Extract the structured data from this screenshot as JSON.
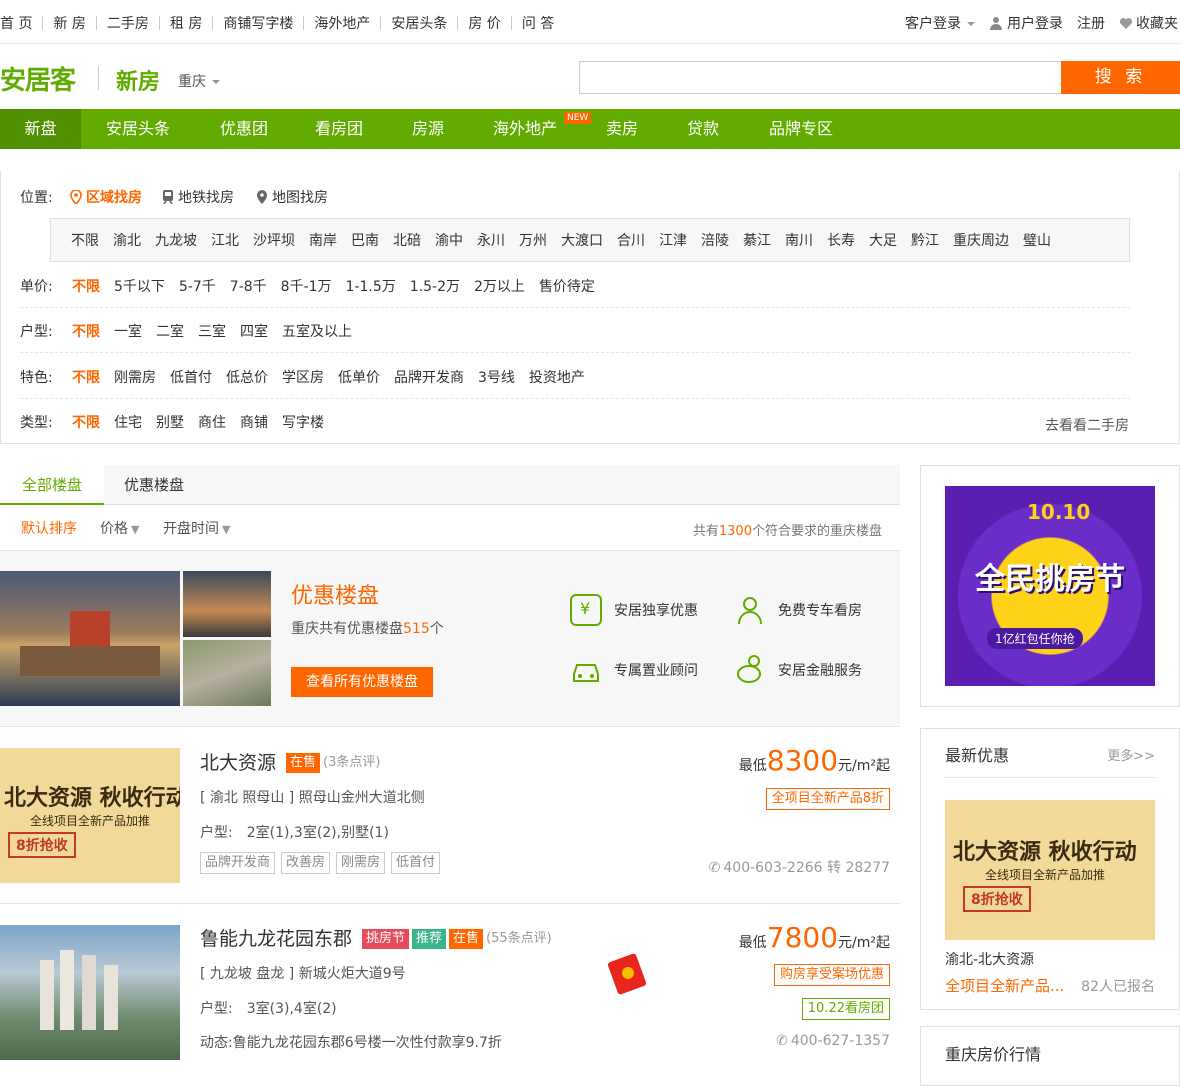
{
  "topbar": {
    "nav": [
      "首 页",
      "新 房",
      "二手房",
      "租 房",
      "商铺写字楼",
      "海外地产",
      "安居头条",
      "房 价",
      "问 答"
    ],
    "customer_login": "客户登录",
    "user_login": "用户登录",
    "register": "注册",
    "favorites": "收藏夹"
  },
  "header": {
    "logo": "安居客",
    "section": "新房",
    "city": "重庆",
    "search_placeholder": "",
    "search_button": "搜 索"
  },
  "mainnav": {
    "items": [
      "新盘",
      "安居头条",
      "优惠团",
      "看房团",
      "房源",
      "海外地产",
      "卖房",
      "贷款",
      "品牌专区"
    ],
    "new_badge": "NEW"
  },
  "filter": {
    "location_label": "位置:",
    "location_tabs": [
      "区域找房",
      "地铁找房",
      "地图找房"
    ],
    "regions": [
      "不限",
      "渝北",
      "九龙坡",
      "江北",
      "沙坪坝",
      "南岸",
      "巴南",
      "北碚",
      "渝中",
      "永川",
      "万州",
      "大渡口",
      "合川",
      "江津",
      "涪陵",
      "綦江",
      "南川",
      "长寿",
      "大足",
      "黔江",
      "重庆周边",
      "璧山"
    ],
    "price_label": "单价:",
    "prices": [
      "不限",
      "5千以下",
      "5-7千",
      "7-8千",
      "8千-1万",
      "1-1.5万",
      "1.5-2万",
      "2万以上",
      "售价待定"
    ],
    "layout_label": "户型:",
    "layouts": [
      "不限",
      "一室",
      "二室",
      "三室",
      "四室",
      "五室及以上"
    ],
    "feature_label": "特色:",
    "features": [
      "不限",
      "刚需房",
      "低首付",
      "低总价",
      "学区房",
      "低单价",
      "品牌开发商",
      "3号线",
      "投资地产"
    ],
    "type_label": "类型:",
    "types": [
      "不限",
      "住宅",
      "别墅",
      "商住",
      "商铺",
      "写字楼"
    ],
    "secondhand_link": "去看看二手房"
  },
  "tabs": {
    "all": "全部楼盘",
    "discount": "优惠楼盘"
  },
  "sort": {
    "default": "默认排序",
    "price": "价格",
    "open_time": "开盘时间",
    "count_prefix": "共有",
    "count": "1300",
    "count_suffix": "个符合要求的重庆楼盘"
  },
  "promo": {
    "title": "优惠楼盘",
    "desc_prefix": "重庆共有优惠楼盘",
    "desc_count": "515",
    "desc_suffix": "个",
    "button": "查看所有优惠楼盘",
    "features": [
      "安居独享优惠",
      "免费专车看房",
      "专属置业顾问",
      "安居金融服务"
    ]
  },
  "listings": [
    {
      "name": "北大资源",
      "tags": [
        "在售"
      ],
      "reviews": "(3条点评)",
      "address": "[ 渝北 照母山 ] 照母山金州大道北侧",
      "layout_label": "户型:",
      "layout": "2室(1),3室(2),别墅(1)",
      "feature_tags": [
        "品牌开发商",
        "改善房",
        "刚需房",
        "低首付"
      ],
      "price_prefix": "最低",
      "price": "8300",
      "price_unit": "元/m²起",
      "promo": "全项目全新产品8折",
      "phone": "400-603-2266 转 28277",
      "img_text": "北大资源 秋收行动",
      "img_sub": "全线项目全新产品加推",
      "img_badge": "8折抢收"
    },
    {
      "name": "鲁能九龙花园东郡",
      "tags": [
        "挑房节",
        "推荐",
        "在售"
      ],
      "reviews": "(55条点评)",
      "address": "[ 九龙坡 盘龙 ] 新城火炬大道9号",
      "layout_label": "户型:",
      "layout": "3室(3),4室(2)",
      "dynamic_label": "动态:",
      "dynamic": "鲁能九龙花园东郡6号楼一次性付款享9.7折",
      "price_prefix": "最低",
      "price": "7800",
      "price_unit": "元/m²起",
      "promo": "购房享受案场优惠",
      "promo2": "10.22看房团",
      "phone": "400-627-1357"
    }
  ],
  "side": {
    "ad_top": "10.10",
    "ad_title": "全民挑房节",
    "ad_sub": "1亿红包任你抢",
    "latest_title": "最新优惠",
    "more": "更多>>",
    "latest_name": "渝北-北大资源",
    "latest_desc": "全项目全新产品...",
    "latest_count": "82人已报名",
    "market_title": "重庆房价行情"
  },
  "colors": {
    "green": "#62ab00",
    "orange": "#ff6600"
  }
}
